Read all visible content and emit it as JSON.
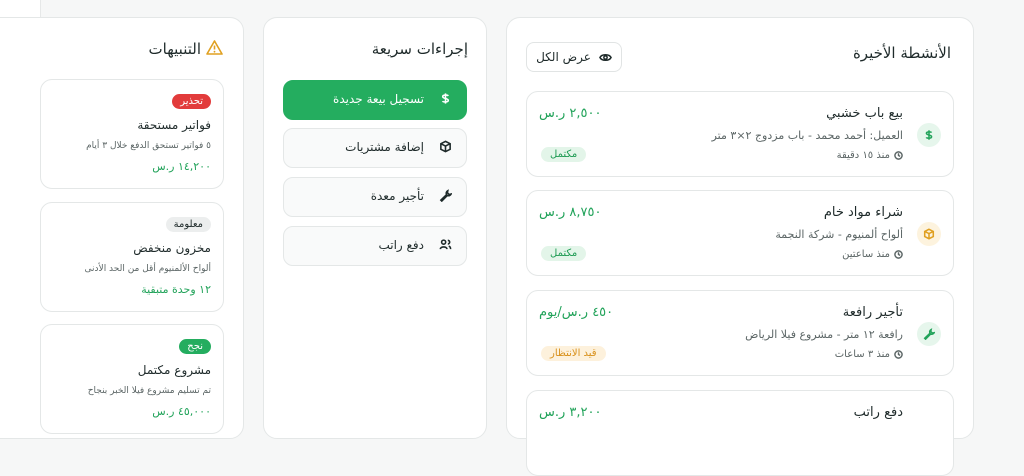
{
  "colors": {
    "accent": "#24ad5f",
    "amount": "#22a35a",
    "warning": "#e0a020",
    "danger": "#e23b3b"
  },
  "sidebar_icons": [
    "building-icon",
    "document-icon",
    "dollar-icon",
    "users-icon",
    "card-icon",
    "file-icon",
    "user-check-icon",
    "gear-icon"
  ],
  "recent": {
    "title": "الأنشطة الأخيرة",
    "view_all": "عرض الكل",
    "items": [
      {
        "title": "بيع باب خشبي",
        "subtitle": "العميل: أحمد محمد - باب مزدوج ٢×٣ متر",
        "time": "منذ ١٥ دقيقة",
        "amount": "٢,٥٠٠ ر.س",
        "status": "مكتمل",
        "icon": "dollar-icon"
      },
      {
        "title": "شراء مواد خام",
        "subtitle": "ألواح ألمنيوم - شركة النجمة",
        "time": "منذ ساعتين",
        "amount": "٨,٧٥٠ ر.س",
        "status": "مكتمل",
        "icon": "box-icon"
      },
      {
        "title": "تأجير رافعة",
        "subtitle": "رافعة ١٢ متر - مشروع فيلا الرياض",
        "time": "منذ ٣ ساعات",
        "amount": "٤٥٠ ر.س/يوم",
        "status": "قيد الانتظار",
        "icon": "wrench-icon"
      },
      {
        "title": "دفع راتب",
        "amount": "٣,٢٠٠ ر.س"
      }
    ]
  },
  "quick": {
    "title": "إجراءات سريعة",
    "items": [
      {
        "label": "تسجيل بيعة جديدة",
        "icon": "dollar-icon"
      },
      {
        "label": "إضافة مشتريات",
        "icon": "box-icon"
      },
      {
        "label": "تأجير معدة",
        "icon": "wrench-icon"
      },
      {
        "label": "دفع راتب",
        "icon": "users-icon"
      }
    ]
  },
  "alerts": {
    "title": "التنبيهات",
    "items": [
      {
        "badge": "تحذير",
        "title": "فواتير مستحقة",
        "desc": "٥ فواتير تستحق الدفع خلال ٣ أيام",
        "value": "١٤,٢٠٠ ر.س"
      },
      {
        "badge": "معلومة",
        "title": "مخزون منخفض",
        "desc": "ألواح الألمنيوم أقل من الحد الأدنى",
        "value": "١٢ وحدة متبقية"
      },
      {
        "badge": "نجح",
        "title": "مشروع مكتمل",
        "desc": "تم تسليم مشروع فيلا الخبر بنجاح",
        "value": "٤٥,٠٠٠ ر.س"
      }
    ]
  }
}
